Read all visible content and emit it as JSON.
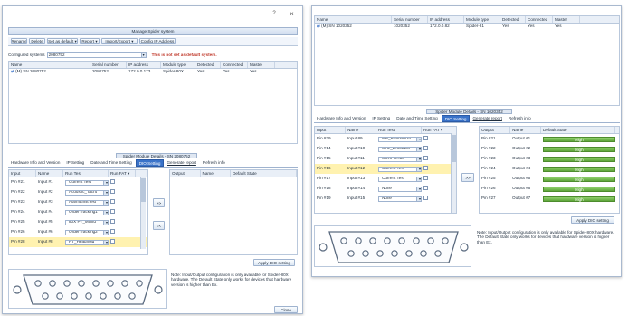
{
  "left": {
    "close_glyph": "×",
    "help_glyph": "?",
    "title": "Manage Spider system",
    "toolbar": [
      "Rename",
      "Delete",
      "Set as default ▾",
      "Report ▾",
      "Import/Export ▾",
      "Config IP Address"
    ],
    "config_label": "Configured systems",
    "config_value": "2080752",
    "warning": "This is not set as default system.",
    "system_headers": [
      "Name",
      "Serial number",
      "IP address",
      "Module type",
      "Detected",
      "Connected",
      "Master"
    ],
    "system_row": [
      "(M) SN 2080752",
      "2080752",
      "172.0.0.173",
      "Spider-80X",
      "Yes",
      "Yes",
      "Yes"
    ],
    "module_header": "Spider Module Details - SN 2080752",
    "tabs": [
      "Hardware Info and Version",
      "IP Setting",
      "Date and Time Setting",
      "DIO Setting",
      "Generate report",
      "Refresh info"
    ],
    "input_headers": [
      "Input",
      "Name",
      "Run Test",
      "Run FAT ▾"
    ],
    "inputs": [
      [
        "Pin #21",
        "Input #1",
        "Current Test"
      ],
      [
        "Pin #22",
        "Input #2",
        "Acoustic_Tacht"
      ],
      [
        "Pin #23",
        "Input #3",
        "AlarmLimitTest"
      ],
      [
        "Pin #24",
        "Input #4",
        "OrderTracking1"
      ],
      [
        "Pin #25",
        "Input #5",
        "80X PT_Mullid"
      ],
      [
        "Pin #26",
        "Input #6",
        "OrderTracking2"
      ],
      [
        "Pin #28",
        "Input #8",
        "RT_Headhold"
      ]
    ],
    "arrow_right": ">>",
    "arrow_left": "<<",
    "output_headers": [
      "Output",
      "Name",
      "Default State"
    ],
    "apply_label": "Apply DIO setting",
    "note": "Note: Input/Output configuration is only available for Spider-80X hardware. The Default State only works for devices that hardware version is higher than Ex.",
    "close_label": "Close"
  },
  "right": {
    "system_headers": [
      "Name",
      "Serial number",
      "IP address",
      "Module type",
      "Detected",
      "Connected",
      "Master"
    ],
    "system_row": [
      "(M) SN 1020352",
      "1020352",
      "172.0.0.82",
      "Spider-81",
      "Yes",
      "Yes",
      "Yes"
    ],
    "module_header": "Spider Module Details - SN 1020352",
    "tabs": [
      "Hardware Info and Version",
      "IP Setting",
      "Date and Time Setting",
      "DIO Setting",
      "Generate report",
      "Refresh info"
    ],
    "input_headers": [
      "Input",
      "Name",
      "Run Test",
      "Run FAT ▾"
    ],
    "inputs": [
      [
        "Pin #29",
        "Input #9",
        "MR_Random20"
      ],
      [
        "Pin #14",
        "Input #10",
        "Sine_Linear187"
      ],
      [
        "Pin #15",
        "Input #11",
        "SORFOR18"
      ],
      [
        "Pin #16",
        "Input #12",
        "Current Test"
      ],
      [
        "Pin #17",
        "Input #13",
        "Current Test"
      ],
      [
        "Pin #18",
        "Input #14",
        "None"
      ],
      [
        "Pin #19",
        "Input #15",
        "None"
      ]
    ],
    "arrow_right": ">>",
    "output_headers": [
      "Output",
      "Name",
      "Default State"
    ],
    "outputs": [
      [
        "Pin #21",
        "Output #1",
        "High"
      ],
      [
        "Pin #22",
        "Output #2",
        "High"
      ],
      [
        "Pin #23",
        "Output #3",
        "High"
      ],
      [
        "Pin #24",
        "Output #4",
        "High"
      ],
      [
        "Pin #25",
        "Output #5",
        "High"
      ],
      [
        "Pin #26",
        "Output #6",
        "High"
      ],
      [
        "Pin #27",
        "Output #7",
        "High"
      ]
    ],
    "apply_label": "Apply DIO setting",
    "note": "Note: Input/Output configuration is only available for Spider-80X hardware. The Default State only works for devices that hardware version is higher than Ex."
  }
}
